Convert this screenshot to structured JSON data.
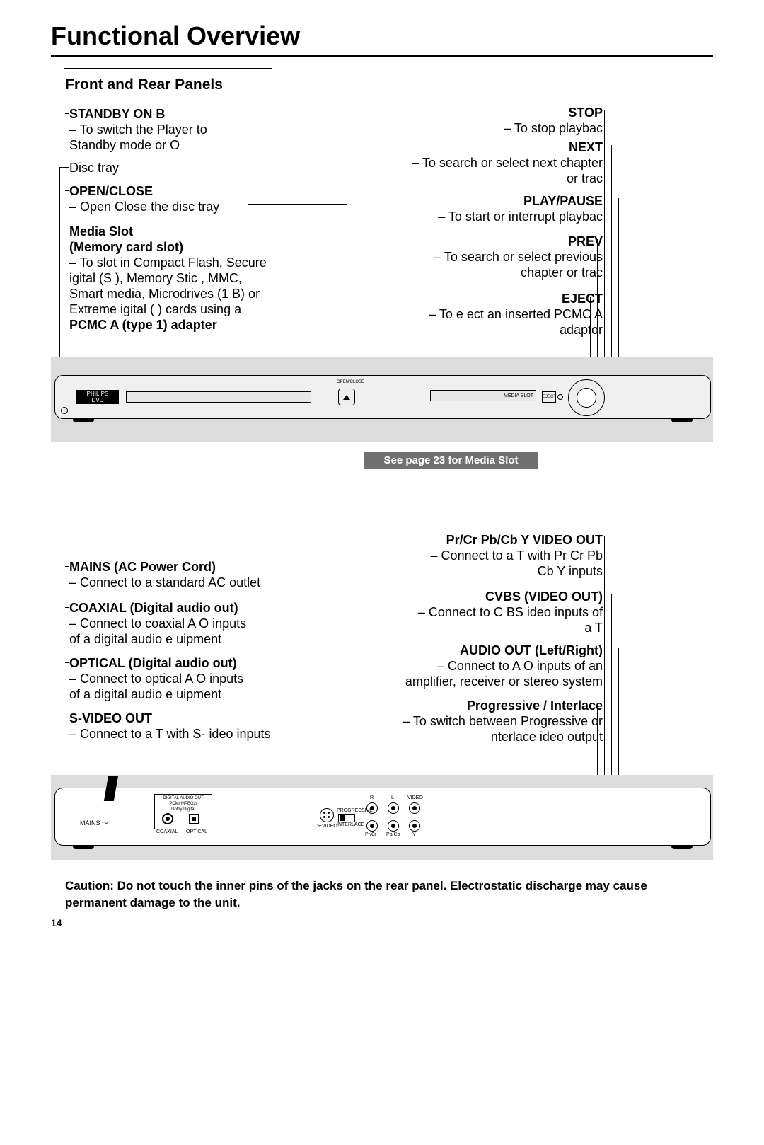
{
  "title": "Functional Overview",
  "section": "Front and Rear Panels",
  "page_number": "14",
  "front_left": {
    "standby": {
      "head": "STANDBY ON B",
      "l1": "–  To switch the         Player to",
      "l2": "    Standby mode or O"
    },
    "disc_tray": "Disc tray",
    "open_close": {
      "head": "OPEN/CLOSE",
      "l1": "–  Open Close the disc tray"
    },
    "media": {
      "head1": "Media Slot",
      "head2": "(Memory card slot)",
      "l1": "–  To slot in Compact Flash, Secure",
      "l2": "     igital (S   ), Memory Stic  , MMC,",
      "l3": "    Smart media, Microdrives (1   B) or",
      "l4": "    Extreme    igital (     ) cards using a",
      "l5": "    PCMC A (type 1) adapter"
    }
  },
  "front_right": {
    "stop": {
      "head": "STOP",
      "l1": "– To stop playbac"
    },
    "next": {
      "head": "NEXT",
      "l1": "– To search or select next chapter",
      "l2": "or trac"
    },
    "play": {
      "head": "PLAY/PAUSE",
      "l1": "– To start or interrupt playbac"
    },
    "prev": {
      "head": "PREV",
      "l1": "– To search or select previous",
      "l2": "chapter or trac"
    },
    "eject": {
      "head": "EJECT",
      "l1": "– To e ect an inserted PCMC A",
      "l2": "adaptor"
    }
  },
  "callout_box": "See page 23 for Media Slot",
  "rear_left": {
    "mains": {
      "head": "MAINS (AC Power Cord)",
      "l1": "–  Connect to a standard AC outlet"
    },
    "coax": {
      "head": "COAXIAL (Digital audio out)",
      "l1": "–  Connect to coaxial A      O inputs",
      "l2": "    of a digital audio e  uipment"
    },
    "opt": {
      "head": "OPTICAL (Digital audio out)",
      "l1": "–  Connect to optical A      O inputs",
      "l2": "    of a digital audio e  uipment"
    },
    "svid": {
      "head": "S-VIDEO OUT",
      "l1": "–  Connect to a T    with S-  ideo inputs"
    }
  },
  "rear_right": {
    "comp": {
      "head": "Pr/Cr Pb/Cb Y VIDEO OUT",
      "l1": "– Connect to a T     with Pr Cr Pb",
      "l2": "Cb Y inputs"
    },
    "cvbs": {
      "head": "CVBS (VIDEO OUT)",
      "l1": "– Connect to C  BS   ideo inputs of",
      "l2": "a T"
    },
    "audio": {
      "head": "AUDIO OUT (Left/Right)",
      "l1": "– Connect to A       O inputs of an",
      "l2": "amplifier, receiver or stereo system"
    },
    "prog": {
      "head": "Progressive / Interlace",
      "l1": "– To switch between Progressive or",
      "l2": "nterlace   ideo output"
    }
  },
  "caution": "Caution: Do not touch the inner pins of the jacks on the rear panel. Electrostatic discharge may cause permanent damage to the unit.",
  "panel": {
    "media_slot": "MEDIA SLOT",
    "eject": "EJECT",
    "oc": "OPEN/CLOSE",
    "mains": "MAINS ～",
    "dig_out": "DIGITAL AUDIO OUT",
    "pcm": "PCM/ MPEG2/",
    "dolby": "Dolby Digital",
    "coax": "COAXIAL",
    "opt": "OPTICAL",
    "svideo": "S-VIDEO",
    "prog": "PROGRESSIVE",
    "inter": "INTERLACE",
    "r": "R",
    "l": "L",
    "video": "VIDEO",
    "pr": "Pr/Cr",
    "pb": "Pb/Cb",
    "y": "Y"
  }
}
